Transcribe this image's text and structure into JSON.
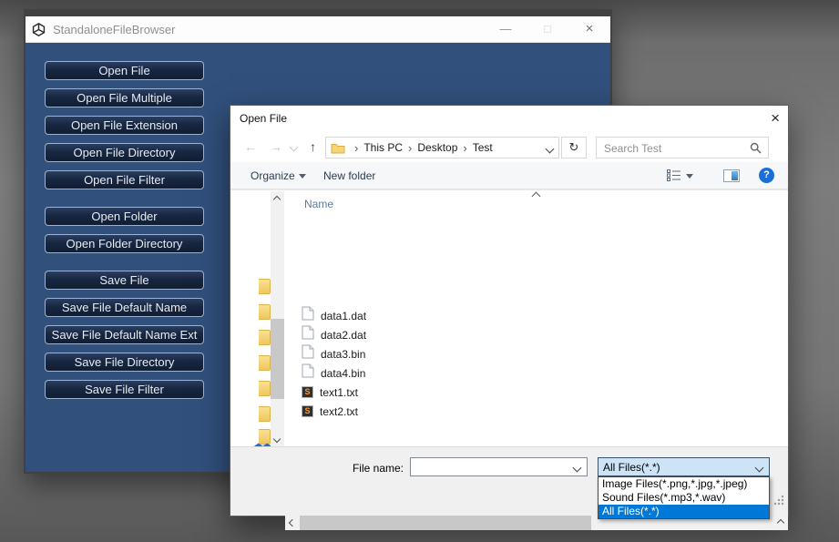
{
  "glyphs": {
    "minimize": "—",
    "maximize": "□",
    "close": "×",
    "back_arrow": "←",
    "forward_arrow": "→",
    "up_arrow": "↑",
    "refresh": "↻",
    "breadcrumb_separator": "›",
    "help": "?",
    "sublime_letter": "S"
  },
  "unity_window": {
    "title": "StandaloneFileBrowser",
    "buttons": [
      "Open File",
      "Open File Multiple",
      "Open File Extension",
      "Open File Directory",
      "Open File Filter",
      "Open Folder",
      "Open Folder Directory",
      "Save File",
      "Save File Default Name",
      "Save File Default Name Ext",
      "Save File Directory",
      "Save File Filter"
    ],
    "colors": {
      "content_background": "#31507C",
      "button_background": "#16253F",
      "button_border": "#A8B2BE"
    }
  },
  "dialog": {
    "title": "Open File",
    "address_bar": {
      "breadcrumbs": [
        "This PC",
        "Desktop",
        "Test"
      ]
    },
    "search": {
      "placeholder": "Search Test"
    },
    "commands": {
      "organize": "Organize",
      "new_folder": "New folder"
    },
    "list": {
      "header": "Name",
      "files": [
        {
          "name": "data1.dat",
          "icon": "generic-file"
        },
        {
          "name": "data2.dat",
          "icon": "generic-file"
        },
        {
          "name": "data3.bin",
          "icon": "generic-file"
        },
        {
          "name": "data4.bin",
          "icon": "generic-file"
        },
        {
          "name": "text1.txt",
          "icon": "text-file"
        },
        {
          "name": "text2.txt",
          "icon": "text-file"
        }
      ]
    },
    "footer": {
      "file_name_label": "File name:",
      "file_name_value": "",
      "file_type_selected": "All Files(*.*)",
      "file_type_options": [
        "Image Files(*.png,*.jpg,*.jpeg)",
        "Sound Files(*.mp3,*.wav)",
        "All Files(*.*)"
      ],
      "highlighted_option": "All Files(*.*)"
    },
    "colors": {
      "selection": "#0078D7",
      "combo_open_background": "#CDE4F7",
      "help_icon": "#1B6FD6"
    }
  }
}
